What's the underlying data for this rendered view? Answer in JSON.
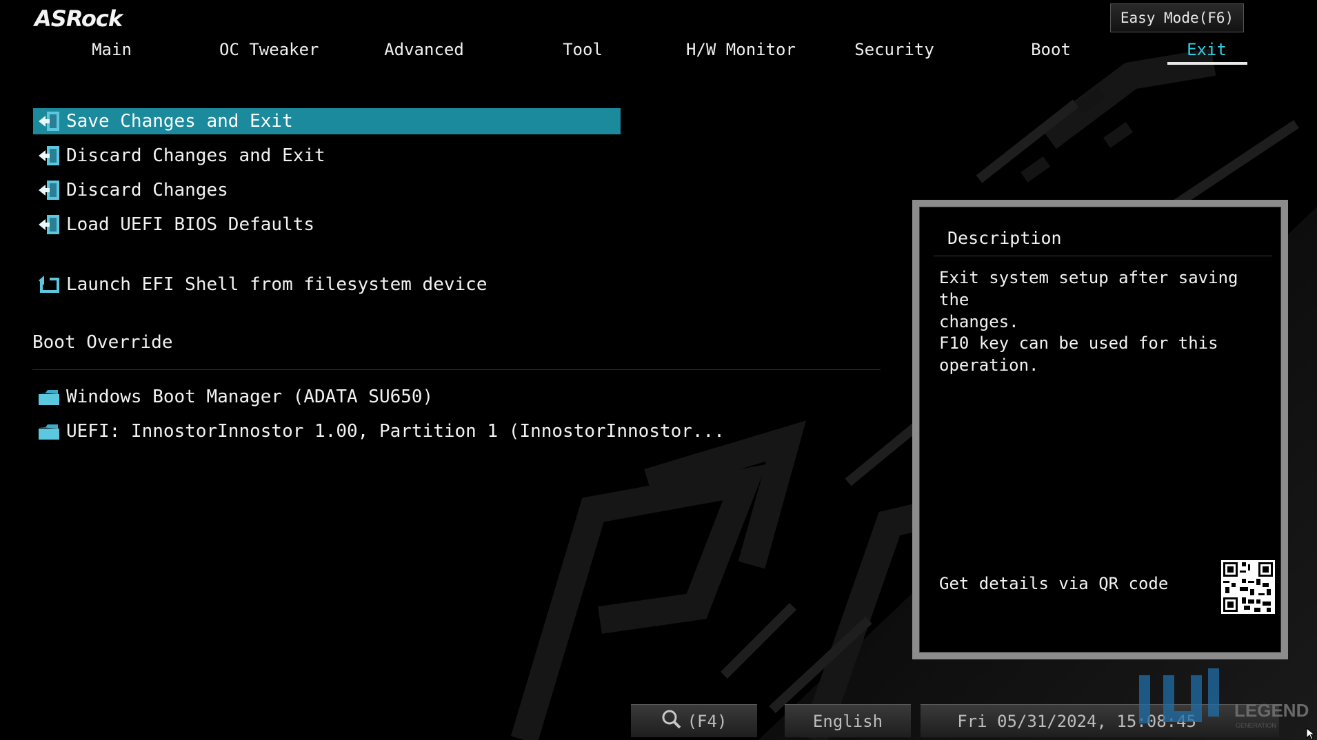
{
  "brand": {
    "logo_text": "ASRock"
  },
  "header": {
    "easy_mode_label": "Easy Mode(F6)"
  },
  "tabs": [
    {
      "label": "Main",
      "active": false
    },
    {
      "label": "OC Tweaker",
      "active": false
    },
    {
      "label": "Advanced",
      "active": false
    },
    {
      "label": "Tool",
      "active": false
    },
    {
      "label": "H/W Monitor",
      "active": false
    },
    {
      "label": "Security",
      "active": false
    },
    {
      "label": "Boot",
      "active": false
    },
    {
      "label": "Exit",
      "active": true
    }
  ],
  "menu": {
    "items": [
      {
        "label": "Save Changes and Exit",
        "icon": "exit-door-icon",
        "selected": true
      },
      {
        "label": "Discard Changes and Exit",
        "icon": "exit-door-icon",
        "selected": false
      },
      {
        "label": "Discard Changes",
        "icon": "exit-door-icon",
        "selected": false
      },
      {
        "label": "Load UEFI BIOS Defaults",
        "icon": "exit-door-icon",
        "selected": false
      },
      {
        "label": "Launch EFI Shell from filesystem device",
        "icon": "launch-arrow-icon",
        "selected": false
      }
    ],
    "boot_override_title": "Boot Override",
    "boot_items": [
      {
        "label": "Windows Boot Manager (ADATA SU650)",
        "icon": "folder-icon"
      },
      {
        "label": "UEFI: InnostorInnostor 1.00, Partition 1 (InnostorInnostor...",
        "icon": "folder-icon"
      }
    ]
  },
  "description": {
    "title": "Description",
    "paragraph_1": "Exit system setup after saving the\nchanges.",
    "paragraph_2": "F10 key can be used for this\noperation.",
    "qr_label": "Get details via QR code"
  },
  "footer": {
    "search_label": "(F4)",
    "language": "English",
    "datetime": "Fri 05/31/2024, 15:08:45"
  },
  "watermark": {
    "text": "LEGEND",
    "subtext": "GENERATION"
  },
  "colors": {
    "accent": "#2fd0e6",
    "highlight": "#1b8a9d",
    "panel_border": "#8c8c8c"
  }
}
